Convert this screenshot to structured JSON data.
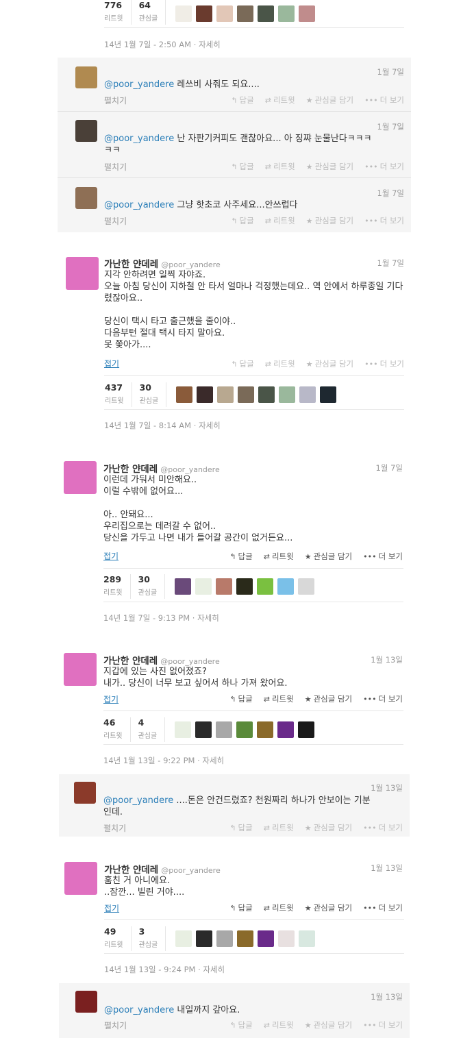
{
  "top": {
    "retweets": "776",
    "retweets_label": "리트윗",
    "favorites": "64",
    "favorites_label": "관심글",
    "timestamp": "14년 1월 7일 - 2:50 AM · 자세히"
  },
  "actions": {
    "reply": "답글",
    "retweet": "리트윗",
    "favorite": "관심글 담기",
    "more": "더 보기"
  },
  "expand_label": "펼치기",
  "collapse_label": "접기",
  "replies1": [
    {
      "mention": "@poor_yandere",
      "text": "레쓰비 사줘도 되요....",
      "time": "1월 7일",
      "color": "#b08a50"
    },
    {
      "mention": "@poor_yandere",
      "text": "난 자판기커피도 괜찮아요... 아 징쨔 눈물난다ㅋㅋㅋ\nㅋㅋ",
      "time": "1월 7일",
      "color": "#4a4038"
    },
    {
      "mention": "@poor_yandere",
      "text": "그냥 핫초코 사주세요...안쓰럽다",
      "time": "1월 7일",
      "color": "#8e6f55"
    }
  ],
  "tweet1": {
    "name": "가난한 얀데레",
    "handle": "@poor_yandere",
    "time": "1월 7일",
    "text": "지각 안하려면 일찍 자야죠.\n오늘 아침 당신이 지하철 안 타서 얼마나 걱정했는데요.. 역 안에서 하루종일 기다렸잖아요..\n\n당신이 택시 타고 출근했을 줄이야..\n다음부턴 절대 택시 타지 말아요.\n못 쫓아가....",
    "retweets": "437",
    "favorites": "30",
    "timestamp": "14년 1월 7일 - 8:14 AM · 자세히"
  },
  "tweet2": {
    "name": "가난한 얀데레",
    "handle": "@poor_yandere",
    "time": "1월 7일",
    "text": "이런데 가둬서 미안해요..\n이럴 수밖에 없어요...\n\n아.. 안돼요...\n우리집으로는 데려갈 수 없어..\n당신을 가두고 나면 내가 들어갈 공간이 없거든요...",
    "retweets": "289",
    "favorites": "30",
    "timestamp": "14년 1월 7일 - 9:13 PM · 자세히"
  },
  "tweet3": {
    "name": "가난한 얀데레",
    "handle": "@poor_yandere",
    "time": "1월 13일",
    "text": "지갑에 있는 사진 없어졌죠?\n내가.. 당신이 너무 보고 싶어서 하나 가져 왔어요.",
    "retweets": "46",
    "favorites": "4",
    "timestamp": "14년 1월 13일 - 9:22 PM · 자세히"
  },
  "reply2": {
    "mention": "@poor_yandere",
    "text": "....돈은 안건드렸죠? 천원짜리 하나가 안보이는 기분\n인데.",
    "time": "1월 13일",
    "color": "#8b3a2a"
  },
  "tweet4": {
    "name": "가난한 얀데레",
    "handle": "@poor_yandere",
    "time": "1월 13일",
    "text": "훔친 거 아니에요.\n..잠깐... 빌린 거야....",
    "retweets": "49",
    "favorites": "3",
    "timestamp": "14년 1월 13일 - 9:24 PM · 자세히"
  },
  "reply3": {
    "mention": "@poor_yandere",
    "text": "내일까지 갚아요.",
    "time": "1월 13일",
    "color": "#7a2020"
  },
  "colors": {
    "link": "#2a7eb8",
    "panel": "#f5f5f5",
    "avatar_pink": "#e070c0"
  }
}
